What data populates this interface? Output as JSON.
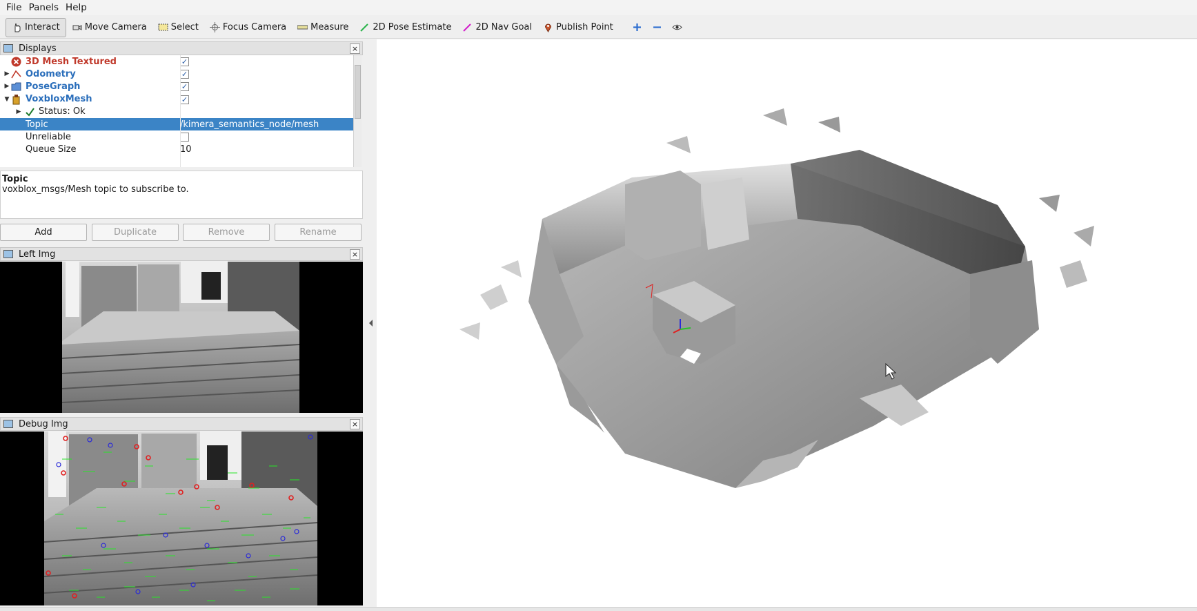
{
  "menu": {
    "file": "File",
    "panels": "Panels",
    "help": "Help"
  },
  "toolbar": {
    "interact": "Interact",
    "move_camera": "Move Camera",
    "select": "Select",
    "focus_camera": "Focus Camera",
    "measure": "Measure",
    "pose_estimate": "2D Pose Estimate",
    "nav_goal": "2D Nav Goal",
    "publish_point": "Publish Point"
  },
  "displays": {
    "title": "Displays",
    "items": [
      {
        "label": "3D Mesh Textured",
        "color": "#c0392b"
      },
      {
        "label": "Odometry",
        "color": "#2a6ebb"
      },
      {
        "label": "PoseGraph",
        "color": "#2a6ebb"
      },
      {
        "label": "VoxbloxMesh",
        "color": "#2a6ebb"
      }
    ],
    "status": "Status: Ok",
    "topic_label": "Topic",
    "topic_value": "/kimera_semantics_node/mesh",
    "unreliable_label": "Unreliable",
    "queue_label": "Queue Size",
    "queue_value": "10"
  },
  "description": {
    "title": "Topic",
    "text": "voxblox_msgs/Mesh topic to subscribe to."
  },
  "buttons": {
    "add": "Add",
    "duplicate": "Duplicate",
    "remove": "Remove",
    "rename": "Rename"
  },
  "left_img": {
    "title": "Left Img"
  },
  "debug_img": {
    "title": "Debug Img"
  },
  "close_glyph": "×",
  "check_glyph": "✓",
  "colors": {
    "selection": "#3b84c6",
    "error": "#c0392b",
    "link": "#2a6ebb"
  }
}
